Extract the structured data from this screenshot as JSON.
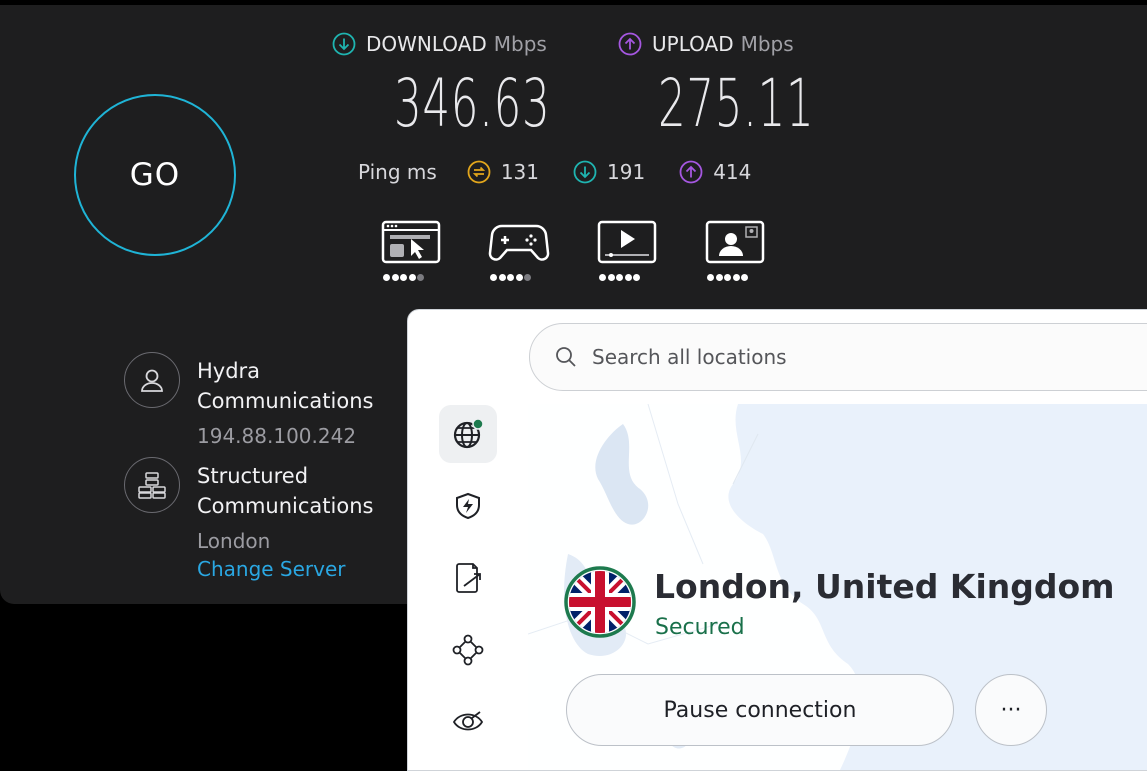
{
  "speedtest": {
    "go_label": "GO",
    "download": {
      "label": "DOWNLOAD",
      "unit": "Mbps",
      "value": "346.63"
    },
    "upload": {
      "label": "UPLOAD",
      "unit": "Mbps",
      "value": "275.11"
    },
    "ping": {
      "label": "Ping ms",
      "idle": "131",
      "down": "191",
      "up": "414"
    },
    "use_cases": [
      {
        "icon": "browsing-icon",
        "rating": 4
      },
      {
        "icon": "gaming-icon",
        "rating": 4
      },
      {
        "icon": "streaming-icon",
        "rating": 5
      },
      {
        "icon": "video-call-icon",
        "rating": 5
      }
    ],
    "isp": {
      "name": "Hydra Communications",
      "ip": "194.88.100.242"
    },
    "server": {
      "name": "Structured Communications",
      "location": "London",
      "change_label": "Change Server"
    },
    "colors": {
      "download": "#1fb4b0",
      "upload": "#a557e0",
      "ping_idle": "#e2a61c",
      "go_ring": "#1fb4d6",
      "link": "#2aa7e2"
    }
  },
  "vpn": {
    "search_placeholder": "Search all locations",
    "rail": [
      {
        "icon": "globe-icon",
        "active": true
      },
      {
        "icon": "shield-bolt-icon"
      },
      {
        "icon": "split-tunnel-icon"
      },
      {
        "icon": "mesh-network-icon"
      },
      {
        "icon": "dark-web-monitor-icon"
      }
    ],
    "location": "London, United Kingdom",
    "status": "Secured",
    "pause_label": "Pause connection",
    "more_label": "···",
    "colors": {
      "secured": "#19704a"
    }
  }
}
